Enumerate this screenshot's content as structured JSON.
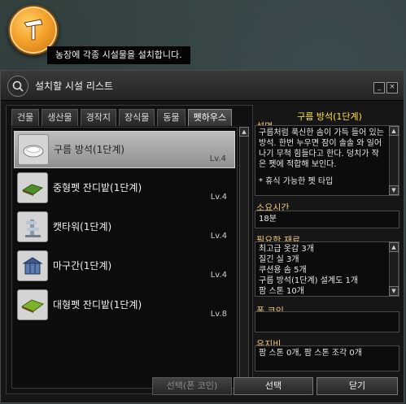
{
  "hint": "농장에 각종 시설물을 설치합니다.",
  "window": {
    "title": "설치할 시설 리스트",
    "minimize_label": "_",
    "close_label": "×"
  },
  "tabs": [
    {
      "label": "건물",
      "active": false
    },
    {
      "label": "생산물",
      "active": false
    },
    {
      "label": "경작지",
      "active": false
    },
    {
      "label": "장식물",
      "active": false
    },
    {
      "label": "동물",
      "active": false
    },
    {
      "label": "펫하우스",
      "active": true
    }
  ],
  "items": [
    {
      "name": "구름 방석(1단계)",
      "level": "Lv.4",
      "icon": "cloud-cushion-icon",
      "selected": true
    },
    {
      "name": "중형펫 잔디밭(1단계)",
      "level": "Lv.4",
      "icon": "grass-mat-icon",
      "selected": false
    },
    {
      "name": "캣타워(1단계)",
      "level": "Lv.4",
      "icon": "cat-tower-icon",
      "selected": false
    },
    {
      "name": "마구간(1단계)",
      "level": "Lv.4",
      "icon": "stable-icon",
      "selected": false
    },
    {
      "name": "대형펫 잔디밭(1단계)",
      "level": "Lv.8",
      "icon": "large-grass-mat-icon",
      "selected": false
    }
  ],
  "detail": {
    "name": "구름 방석(1단계)",
    "description_label": "설명",
    "description": "구름처럼 푹신한 솜이 가득 들어 있는 방석. 한번 누우면 잠이 솔솔 와 일어나기 무척 힘들다고 한다. 덩치가 작은 펫에 적합해 보인다.",
    "description_note": "* 휴식 가능한 펫 타입",
    "time_label": "소요시간",
    "time_value": "18분",
    "materials_label": "필요한 재료",
    "materials": [
      "최고급 옷감 3개",
      "질긴 실 3개",
      "쿠션용 솜 5개",
      "구름 방석(1단계) 설계도 1개",
      "팜 스톤 10개"
    ],
    "coin_label": "폰 코인",
    "coin_value": "",
    "upkeep_label": "유지비",
    "upkeep_value": "팜 스톤 0개, 팜 스톤 조각 0개"
  },
  "buttons": {
    "select_coin": "선택(폰 코인)",
    "select": "선택",
    "close": "닫기"
  },
  "colors": {
    "detail_name": "#ffe24a",
    "section_label": "#f2c77a",
    "emblem": "#f4a12a"
  }
}
